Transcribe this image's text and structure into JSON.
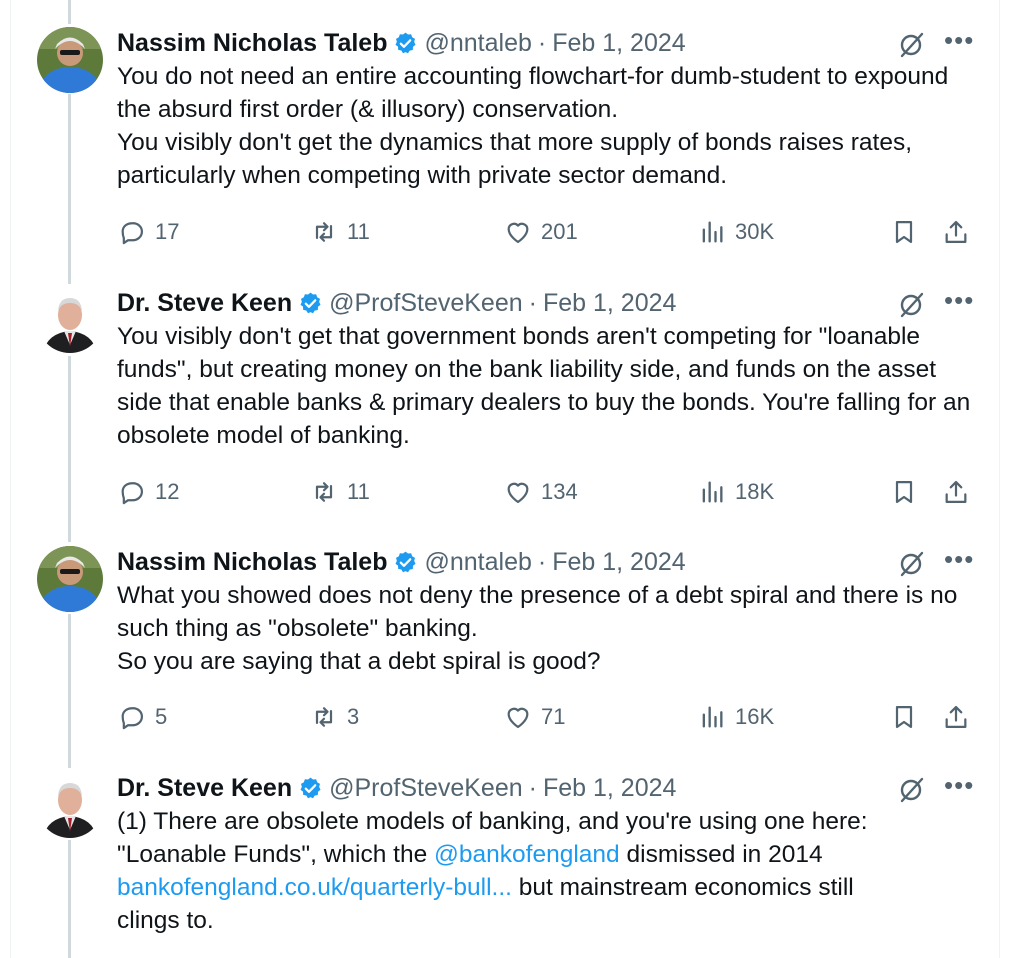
{
  "tweets": [
    {
      "author": "Nassim Nicholas Taleb",
      "handle": "@nntaleb",
      "separator": "·",
      "date": "Feb 1, 2024",
      "lines": [
        "You do not need an entire accounting flowchart-for dumb-student to expound the absurd first order (& illusory) conservation.",
        "You visibly don't get the dynamics that more supply of bonds raises rates, particularly when competing with private sector demand."
      ],
      "replies": "17",
      "reposts": "11",
      "likes": "201",
      "views": "30K"
    },
    {
      "author": "Dr. Steve Keen",
      "handle": "@ProfSteveKeen",
      "separator": "·",
      "date": "Feb 1, 2024",
      "lines": [
        "You visibly don't get that government bonds aren't competing for \"loanable funds\", but creating money on the bank liability side, and funds on the asset side that enable banks & primary dealers to buy the bonds. You're falling for an obsolete model of banking."
      ],
      "replies": "12",
      "reposts": "11",
      "likes": "134",
      "views": "18K"
    },
    {
      "author": "Nassim Nicholas Taleb",
      "handle": "@nntaleb",
      "separator": "·",
      "date": "Feb 1, 2024",
      "lines": [
        "What you showed does not deny the presence of a debt spiral and there is no such thing as \"obsolete\" banking.",
        "So you are saying that a debt spiral is good?"
      ],
      "replies": "5",
      "reposts": "3",
      "likes": "71",
      "views": "16K"
    },
    {
      "author": "Dr. Steve Keen",
      "handle": "@ProfSteveKeen",
      "separator": "·",
      "date": "Feb 1, 2024",
      "text_before_mention": "(1) There are obsolete models of banking, and you're using one here: \"Loanable Funds\", which the ",
      "mention": "@bankofengland",
      "text_after_mention": " dismissed in 2014 ",
      "url": "bankofengland.co.uk/quarterly-bull...",
      "text_after_url": " but mainstream economics still clings to."
    }
  ],
  "colors": {
    "text": "#0f1419",
    "secondary": "#536471",
    "link": "#1d9bf0",
    "verified": "#1d9bf0",
    "thread_line": "#cfd9de"
  },
  "icons": [
    "verified-badge-icon",
    "grok-icon",
    "more-icon",
    "reply-icon",
    "repost-icon",
    "like-icon",
    "views-icon",
    "bookmark-icon",
    "share-icon"
  ]
}
